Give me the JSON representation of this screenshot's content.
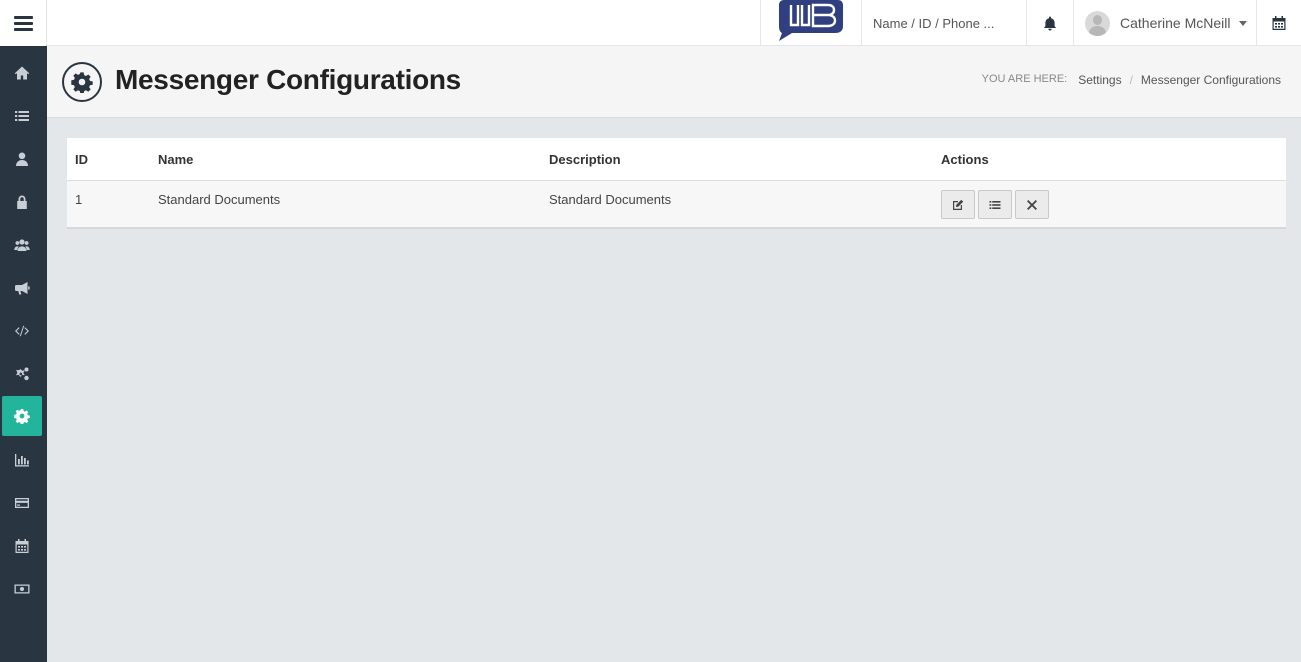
{
  "topbar": {
    "search": {
      "placeholder": "Name / ID / Phone ...",
      "value": ""
    },
    "user": {
      "name": "Catherine McNeill"
    }
  },
  "sidebar": {
    "items": [
      {
        "icon": "home-icon"
      },
      {
        "icon": "list-icon"
      },
      {
        "icon": "user-icon"
      },
      {
        "icon": "lock-icon"
      },
      {
        "icon": "users-icon"
      },
      {
        "icon": "megaphone-icon"
      },
      {
        "icon": "code-icon"
      },
      {
        "icon": "gears-icon"
      },
      {
        "icon": "gear-icon",
        "active": true
      },
      {
        "icon": "bar-chart-icon"
      },
      {
        "icon": "credit-card-icon"
      },
      {
        "icon": "calendar-icon"
      },
      {
        "icon": "money-icon"
      }
    ],
    "active_color": "#22b59b",
    "background_color": "#2a3542"
  },
  "header": {
    "title": "Messenger Configurations",
    "breadcrumb": {
      "label": "YOU ARE HERE:",
      "items": [
        "Settings",
        "Messenger Configurations"
      ],
      "separator": "/"
    }
  },
  "table": {
    "columns": [
      "ID",
      "Name",
      "Description",
      "Actions"
    ],
    "rows": [
      {
        "id": "1",
        "name": "Standard Documents",
        "description": "Standard Documents"
      }
    ]
  }
}
